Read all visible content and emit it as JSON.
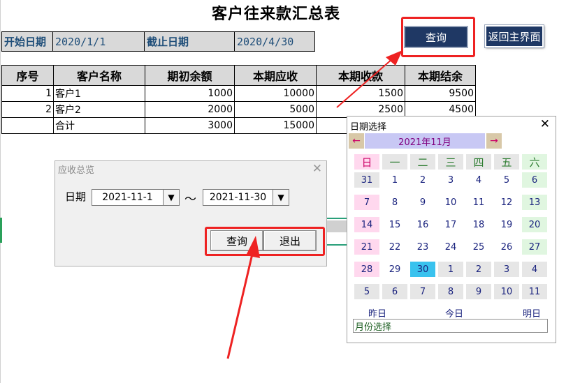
{
  "title": "客户往来款汇总表",
  "header": {
    "start_label": "开始日期",
    "start_value": "2020/1/1",
    "end_label": "截止日期",
    "end_value": "2020/4/30"
  },
  "buttons": {
    "query": "查询",
    "back": "返回主界面"
  },
  "table": {
    "columns": [
      "序号",
      "客户名称",
      "期初余额",
      "本期应收",
      "本期收款",
      "本期结余"
    ],
    "rows": [
      {
        "no": "1",
        "name": "客户1",
        "opening": "1000",
        "receivable": "10000",
        "received": "1500",
        "balance": "9500"
      },
      {
        "no": "2",
        "name": "客户2",
        "opening": "2000",
        "receivable": "5000",
        "received": "2500",
        "balance": "4500"
      }
    ],
    "total": {
      "label": "合计",
      "opening": "3000",
      "receivable": "15000"
    }
  },
  "dialog": {
    "title": "应收总览",
    "date_label": "日期",
    "from": "2021-11-1",
    "to": "2021-11-30",
    "separator": "～",
    "query": "查询",
    "exit": "退出"
  },
  "calendar": {
    "title": "日期选择",
    "month": "2021年11月",
    "prev": "←",
    "next": "→",
    "weekdays": [
      "日",
      "一",
      "二",
      "三",
      "四",
      "五",
      "六"
    ],
    "days": [
      "31",
      "1",
      "2",
      "3",
      "4",
      "5",
      "6",
      "7",
      "8",
      "9",
      "10",
      "11",
      "12",
      "13",
      "14",
      "15",
      "16",
      "17",
      "18",
      "19",
      "20",
      "21",
      "22",
      "23",
      "24",
      "25",
      "26",
      "27",
      "28",
      "29",
      "30",
      "1",
      "2",
      "3",
      "4",
      "5",
      "6",
      "7",
      "8",
      "9",
      "10",
      "11"
    ],
    "selected": "30",
    "yesterday": "昨日",
    "today": "今日",
    "tomorrow": "明日",
    "month_select": "月份选择"
  },
  "colors": {
    "button_bg": "#1f3864",
    "highlight": "#ee2222",
    "header_text": "#1f4e79",
    "selected_day": "#39c2ee"
  }
}
